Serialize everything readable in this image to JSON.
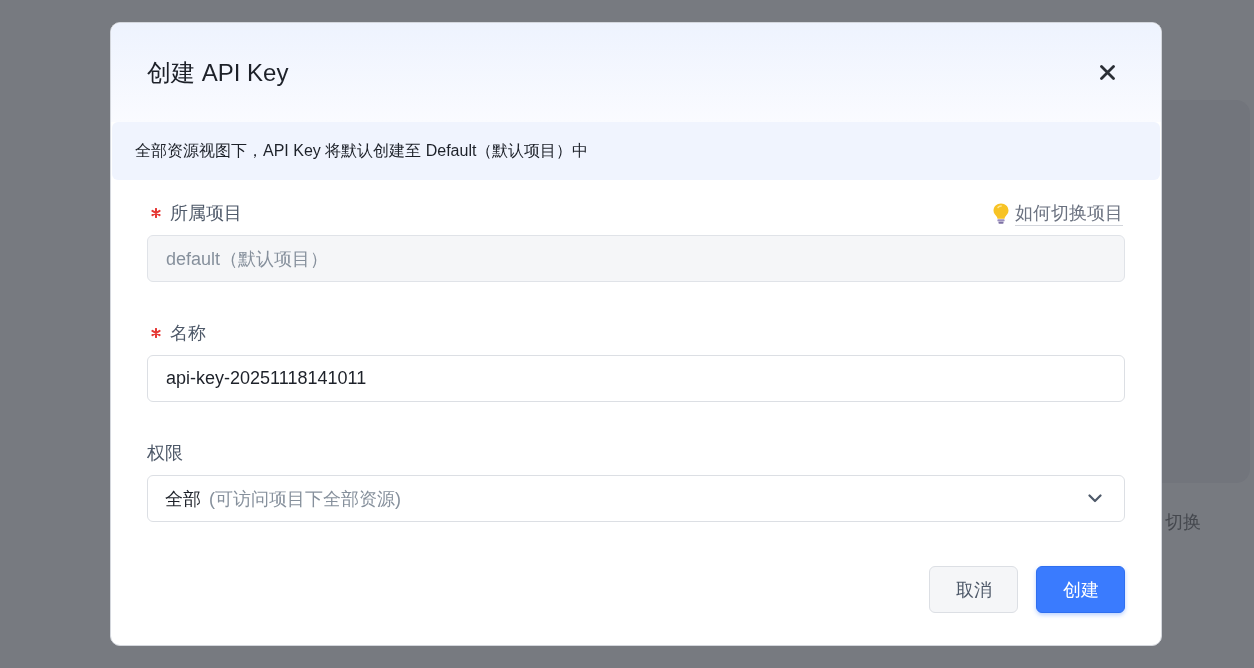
{
  "background": {
    "text": "切换"
  },
  "dialog": {
    "title": "创建 API Key",
    "notice": "全部资源视图下，API Key 将默认创建至 Default（默认项目）中",
    "fields": [
      {
        "kind": "text",
        "label": "所属项目",
        "required": true,
        "help_link": "如何切换项目",
        "value": "default（默认项目）",
        "disabled": true
      },
      {
        "kind": "text",
        "label": "名称",
        "required": true,
        "value": "api-key-20251118141011",
        "disabled": false
      },
      {
        "kind": "select",
        "label": "权限",
        "required": false,
        "value": "全部",
        "description": "(可访问项目下全部资源)"
      }
    ],
    "buttons": [
      {
        "label": "取消",
        "kind": "secondary"
      },
      {
        "label": "创建",
        "kind": "primary"
      }
    ]
  }
}
